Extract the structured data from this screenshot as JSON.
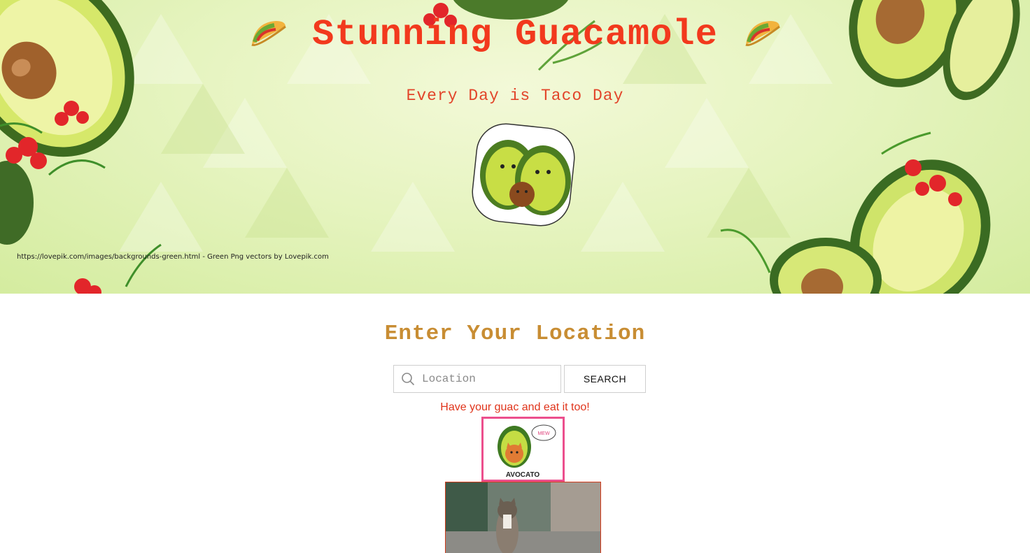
{
  "hero": {
    "title": "Stunning Guacamole",
    "subtitle": "Every Day is Taco Day",
    "credit": "https://lovepik.com/images/backgrounds-green.html - Green Png vectors by Lovepik.com"
  },
  "search": {
    "heading": "Enter Your Location",
    "placeholder": "Location",
    "button_label": "SEARCH"
  },
  "tagline": "Have your guac and eat it too!",
  "avocato": {
    "bubble": "MEW",
    "caption": "AVOCATO"
  },
  "colors": {
    "title": "#f2391d",
    "heading": "#c88d33",
    "tagline": "#e0341b",
    "card_border": "#ec4f8d"
  },
  "icons": [
    "taco-icon",
    "search-icon"
  ]
}
